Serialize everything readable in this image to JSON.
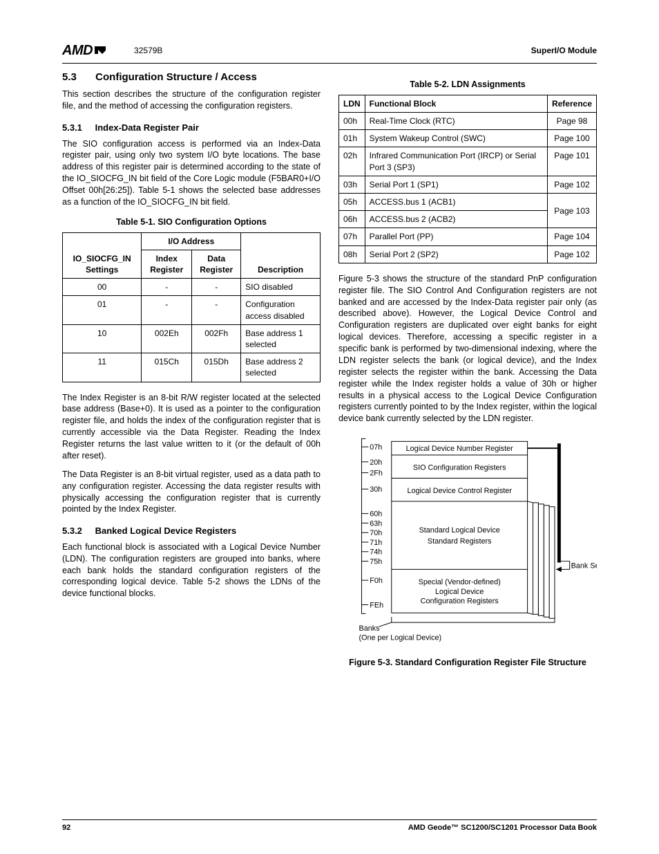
{
  "header": {
    "logo_text": "AMD",
    "doc_code": "32579B",
    "module": "SuperI/O Module"
  },
  "section": {
    "number": "5.3",
    "title": "Configuration Structure / Access",
    "intro": "This section describes the structure of the configuration register file, and the method of accessing the configuration registers."
  },
  "sub531": {
    "number": "5.3.1",
    "title": "Index-Data Register Pair",
    "p1": "The SIO configuration access is performed via an Index-Data register pair, using only two system I/O byte locations. The base address of this register pair is determined according to the state of the IO_SIOCFG_IN bit field of the Core Logic module (F5BAR0+I/O Offset 00h[26:25]). Table 5-1 shows the selected base addresses as a function of the IO_SIOCFG_IN bit field.",
    "p2": "The Index Register is an 8-bit R/W register located at the selected base address (Base+0). It is used as a pointer to the configuration register file, and holds the index of the configuration register that is currently accessible via the Data Register. Reading the Index Register returns the last value written to it (or the default of 00h after reset).",
    "p3": "The Data Register is an 8-bit virtual register, used as a data path to any configuration register. Accessing the data register results with physically accessing the configuration register that is currently pointed by the Index Register."
  },
  "sub532": {
    "number": "5.3.2",
    "title": "Banked Logical Device Registers",
    "p1": "Each functional block is associated with a Logical Device Number (LDN). The configuration registers are grouped into banks, where each bank holds the standard configuration registers of the corresponding logical device. Table 5-2 shows the LDNs of the device functional blocks."
  },
  "table51": {
    "title": "Table 5-1.  SIO Configuration Options",
    "head": {
      "col1": "IO_SIOCFG_IN Settings",
      "group": "I/O Address",
      "col2": "Index Register",
      "col3": "Data Register",
      "col4": "Description"
    },
    "rows": [
      {
        "s": "00",
        "idx": "-",
        "dat": "-",
        "desc": "SIO disabled"
      },
      {
        "s": "01",
        "idx": "-",
        "dat": "-",
        "desc": "Configuration access disabled"
      },
      {
        "s": "10",
        "idx": "002Eh",
        "dat": "002Fh",
        "desc": "Base address 1 selected"
      },
      {
        "s": "11",
        "idx": "015Ch",
        "dat": "015Dh",
        "desc": "Base address 2 selected"
      }
    ]
  },
  "table52": {
    "title": "Table 5-2.  LDN Assignments",
    "head": {
      "c1": "LDN",
      "c2": "Functional Block",
      "c3": "Reference"
    },
    "rows": [
      {
        "ldn": "00h",
        "fb": "Real-Time Clock (RTC)",
        "ref": "Page 98"
      },
      {
        "ldn": "01h",
        "fb": "System Wakeup Control (SWC)",
        "ref": "Page 100"
      },
      {
        "ldn": "02h",
        "fb": "Infrared Communication Port (IRCP) or Serial Port 3 (SP3)",
        "ref": "Page 101"
      },
      {
        "ldn": "03h",
        "fb": "Serial Port 1 (SP1)",
        "ref": "Page 102"
      },
      {
        "ldn": "05h",
        "fb": "ACCESS.bus 1 (ACB1)",
        "ref": "Page 103"
      },
      {
        "ldn": "06h",
        "fb": "ACCESS.bus 2 (ACB2)",
        "ref": ""
      },
      {
        "ldn": "07h",
        "fb": "Parallel Port (PP)",
        "ref": "Page 104"
      },
      {
        "ldn": "08h",
        "fb": "Serial Port 2 (SP2)",
        "ref": "Page 102"
      }
    ]
  },
  "col2": {
    "p1": "Figure 5-3 shows the structure of the standard PnP configuration register file. The SIO Control And Configuration registers are not banked and are accessed by the Index-Data register pair only (as described above). However, the Logical Device Control and Configuration registers are duplicated over eight banks for eight logical devices. Therefore, accessing a specific register in a specific bank is performed by two-dimensional indexing, where the LDN register selects the bank (or logical device), and the Index register selects the register within the bank. Accessing the Data register while the Index register holds a value of 30h or higher results in a physical access to the Logical Device Configuration registers currently pointed to by the Index register, within the logical device bank currently selected by the LDN register."
  },
  "figure53": {
    "caption": "Figure 5-3.  Standard Configuration Register File Structure",
    "addr": {
      "a07h": "07h",
      "a20h": "20h",
      "a2Fh": "2Fh",
      "a30h": "30h",
      "a60h": "60h",
      "a63h": "63h",
      "a70h": "70h",
      "a71h": "71h",
      "a74h": "74h",
      "a75h": "75h",
      "aF0h": "F0h",
      "aFEh": "FEh"
    },
    "labels": {
      "ldnr": "Logical Device Number Register",
      "siocfg": "SIO Configuration Registers",
      "ldcr": "Logical Device Control Register",
      "sld1": "Standard Logical Device",
      "sld2": "Standard Registers",
      "svd1": "Special (Vendor-defined)",
      "svd2": "Logical Device",
      "svd3": "Configuration Registers",
      "banks": "Banks",
      "banks2": "(One per Logical Device)",
      "bsel": "Bank Select"
    }
  },
  "footer": {
    "page": "92",
    "book": "AMD Geode™ SC1200/SC1201 Processor Data Book"
  }
}
